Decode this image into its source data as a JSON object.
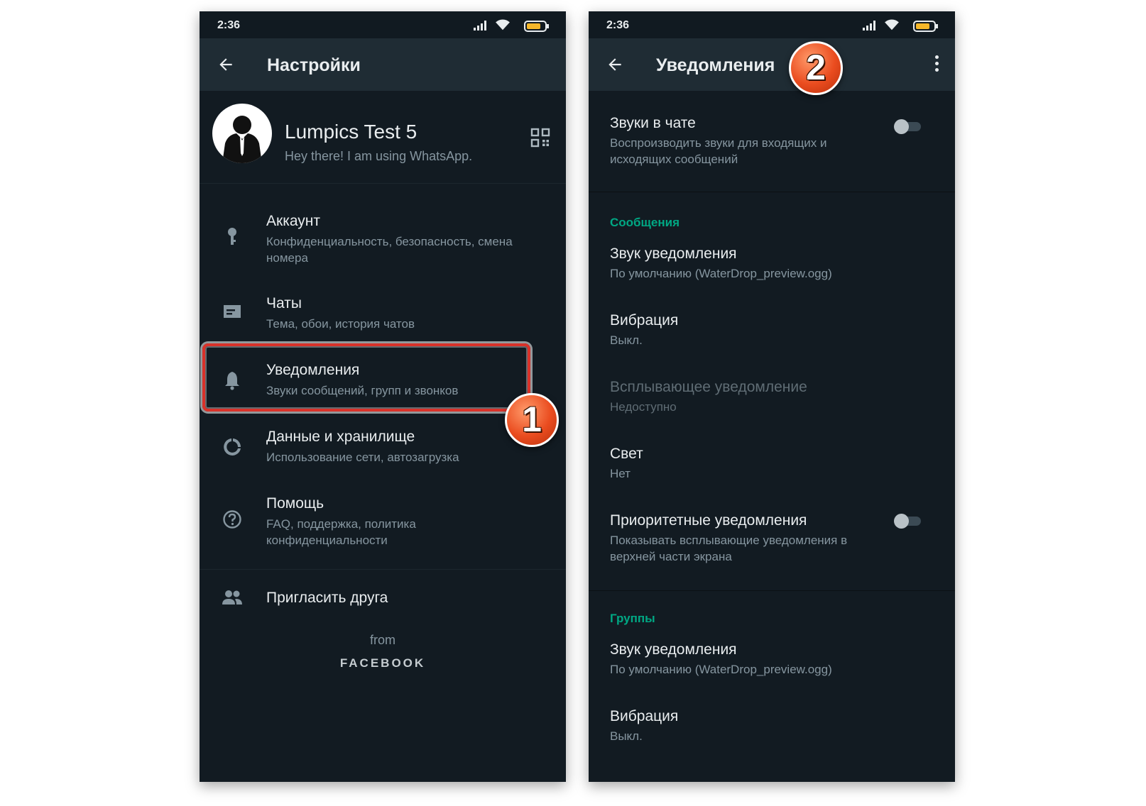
{
  "left_screen": {
    "status_bar": {
      "time": "2:36"
    },
    "app_bar": {
      "title": "Настройки",
      "back_icon": "arrow-left-icon"
    },
    "profile": {
      "name": "Lumpics Test 5",
      "status": "Hey there! I am using WhatsApp.",
      "qr_icon": "qr-code-icon"
    },
    "menu": [
      {
        "icon": "key-icon",
        "title": "Аккаунт",
        "subtitle": "Конфиденциальность, безопасность, смена номера"
      },
      {
        "icon": "chat-icon",
        "title": "Чаты",
        "subtitle": "Тема, обои, история чатов"
      },
      {
        "icon": "bell-icon",
        "title": "Уведомления",
        "subtitle": "Звуки сообщений, групп и звонков"
      },
      {
        "icon": "data-usage-icon",
        "title": "Данные и хранилище",
        "subtitle": "Использование сети, автозагрузка"
      },
      {
        "icon": "help-icon",
        "title": "Помощь",
        "subtitle": "FAQ, поддержка, политика конфиденциальности"
      },
      {
        "icon": "people-icon",
        "title": "Пригласить друга"
      }
    ],
    "footer": {
      "from": "from",
      "brand": "FACEBOOK"
    },
    "badge": "1"
  },
  "right_screen": {
    "status_bar": {
      "time": "2:36"
    },
    "app_bar": {
      "title": "Уведомления",
      "back_icon": "arrow-left-icon",
      "more_icon": "more-vert-icon"
    },
    "badge": "2",
    "chat_sounds": {
      "title": "Звуки в чате",
      "subtitle": "Воспроизводить звуки для входящих и исходящих сообщений",
      "enabled": false
    },
    "messages_section": {
      "header": "Сообщения",
      "items": [
        {
          "title": "Звук уведомления",
          "subtitle": "По умолчанию (WaterDrop_preview.ogg)"
        },
        {
          "title": "Вибрация",
          "subtitle": "Выкл."
        },
        {
          "title": "Всплывающее уведомление",
          "subtitle": "Недоступно",
          "disabled": true
        },
        {
          "title": "Свет",
          "subtitle": "Нет"
        },
        {
          "title": "Приоритетные уведомления",
          "subtitle": "Показывать всплывающие уведомления в верхней части экрана",
          "enabled": false
        }
      ]
    },
    "groups_section": {
      "header": "Группы",
      "items": [
        {
          "title": "Звук уведомления",
          "subtitle": "По умолчанию (WaterDrop_preview.ogg)"
        },
        {
          "title": "Вибрация",
          "subtitle": "Выкл."
        }
      ]
    }
  },
  "colors": {
    "background": "#121b22",
    "app_bar": "#1f2c34",
    "accent": "#00a884",
    "highlight": "#d9322a",
    "badge": "#ea4c1f"
  }
}
